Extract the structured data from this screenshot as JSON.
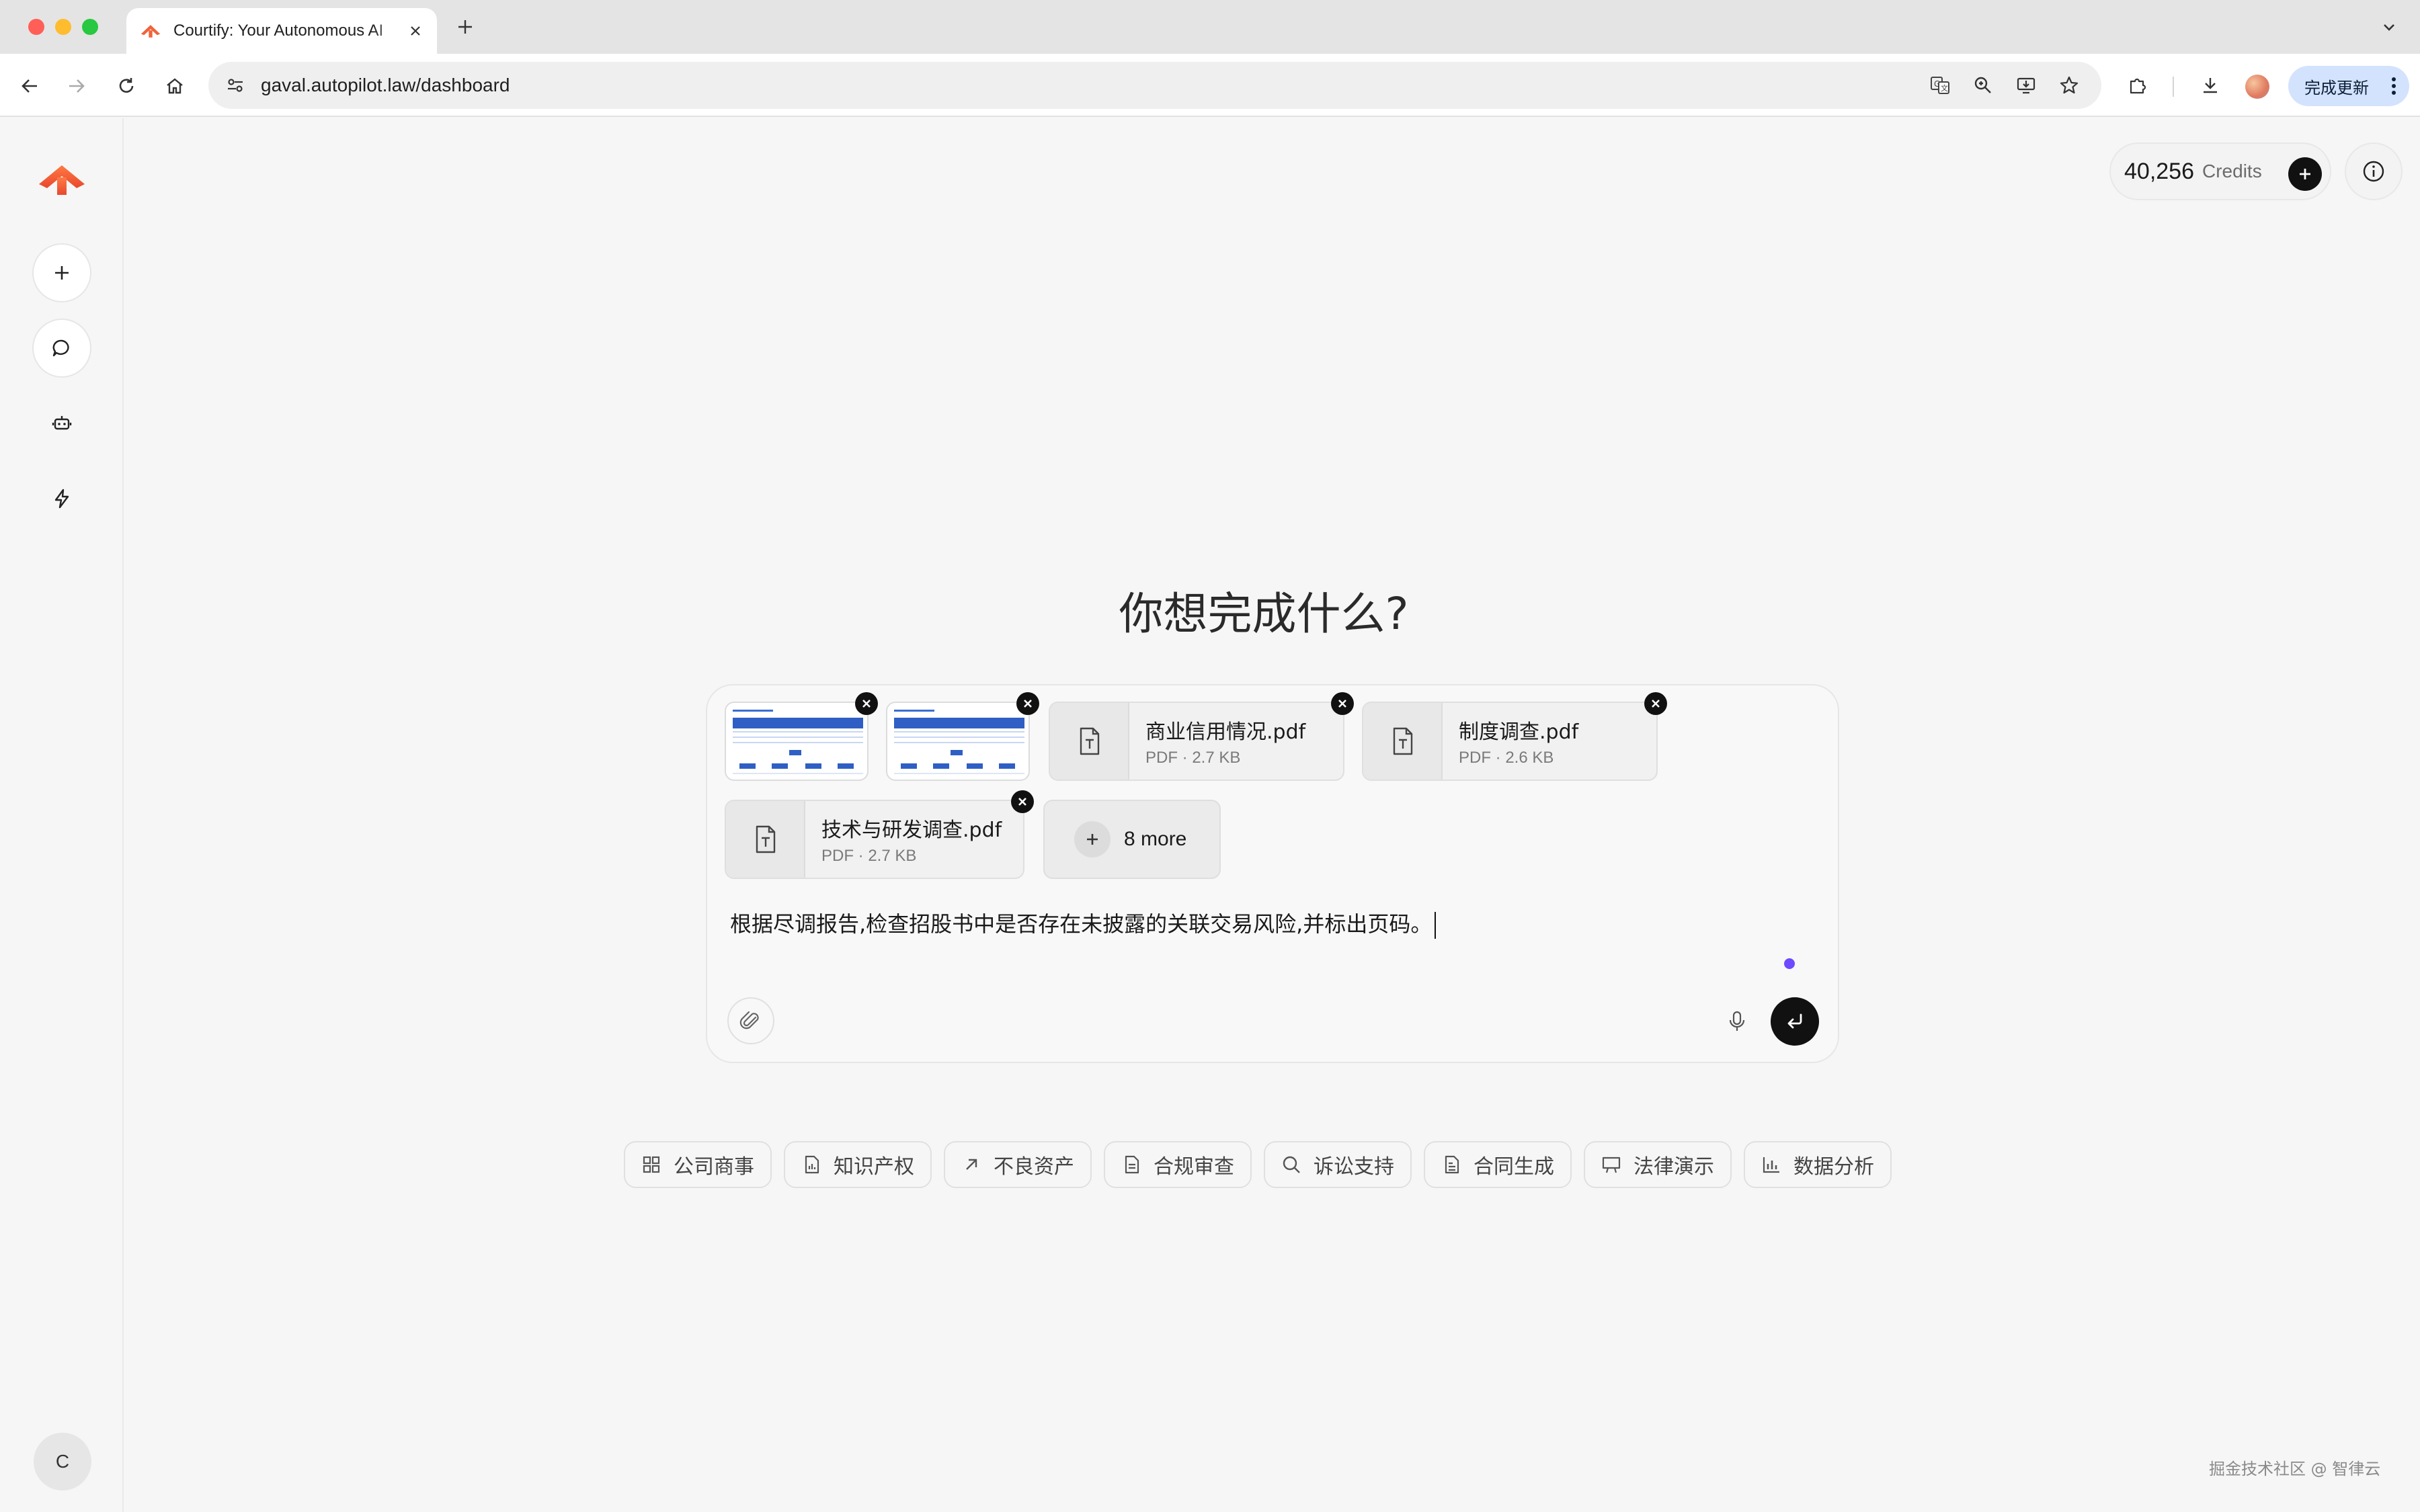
{
  "browser": {
    "tab_title": "Courtify: Your Autonomous AI",
    "url": "gaval.autopilot.law/dashboard",
    "update_label": "完成更新"
  },
  "credits": {
    "value": "40,256",
    "label": "Credits"
  },
  "main": {
    "headline": "你想完成什么?",
    "prompt_text": "根据尽调报告,检查招股书中是否存在未披露的关联交易风险,并标出页码。"
  },
  "attachments": [
    {
      "type": "image",
      "name": "screenshot-1"
    },
    {
      "type": "image",
      "name": "screenshot-2"
    },
    {
      "type": "pdf",
      "name": "商业信用情况.pdf",
      "meta": "PDF · 2.7 KB"
    },
    {
      "type": "pdf",
      "name": "制度调查.pdf",
      "meta": "PDF · 2.6 KB"
    },
    {
      "type": "pdf",
      "name": "技术与研发调查.pdf",
      "meta": "PDF · 2.7 KB"
    }
  ],
  "more_label": "8 more",
  "chips": [
    {
      "label": "公司商事",
      "icon": "grid-icon"
    },
    {
      "label": "知识产权",
      "icon": "document-chart-icon"
    },
    {
      "label": "不良资产",
      "icon": "arrow-up-right-icon"
    },
    {
      "label": "合规审查",
      "icon": "document-icon"
    },
    {
      "label": "诉讼支持",
      "icon": "search-icon"
    },
    {
      "label": "合同生成",
      "icon": "document-lines-icon"
    },
    {
      "label": "法律演示",
      "icon": "presentation-icon"
    },
    {
      "label": "数据分析",
      "icon": "bar-chart-icon"
    }
  ],
  "user": {
    "initial": "C"
  },
  "watermark": "掘金技术社区 @ 智律云",
  "colors": {
    "brand_orange": "#f0643c",
    "accent_purple": "#6d4aff",
    "send_button": "#111111"
  }
}
